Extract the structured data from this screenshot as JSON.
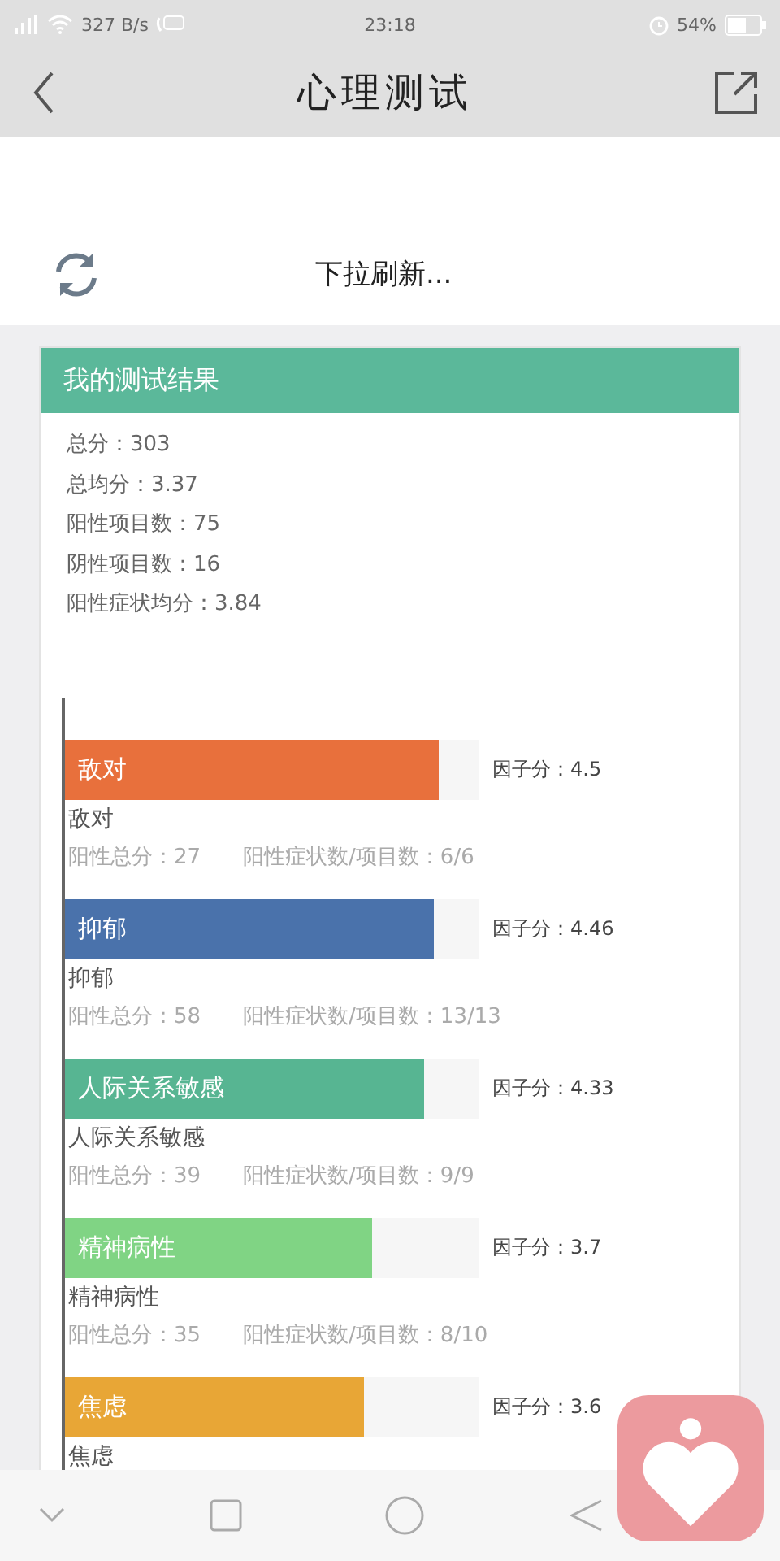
{
  "status_bar": {
    "speed": "327 B/s",
    "time": "23:18",
    "battery": "54%"
  },
  "header": {
    "title": "心理测试"
  },
  "refresh": {
    "label": "下拉刷新..."
  },
  "result_card": {
    "title": "我的测试结果",
    "summary": [
      "总分：303",
      "总均分：3.37",
      "阳性项目数：75",
      "阴性项目数：16",
      "阳性症状均分：3.84"
    ],
    "factors": [
      {
        "name": "敌对",
        "color": "#e8703c",
        "level": 0.9,
        "score": "因子分：4.5",
        "caption": "敌对",
        "positive_total": "阳性总分：27",
        "ratio": "阳性症状数/项目数：6/6"
      },
      {
        "name": "抑郁",
        "color": "#4a72ab",
        "level": 0.892,
        "score": "因子分：4.46",
        "caption": "抑郁",
        "positive_total": "阳性总分：58",
        "ratio": "阳性症状数/项目数：13/13"
      },
      {
        "name": "人际关系敏感",
        "color": "#57b592",
        "level": 0.866,
        "score": "因子分：4.33",
        "caption": "人际关系敏感",
        "positive_total": "阳性总分：39",
        "ratio": "阳性症状数/项目数：9/9"
      },
      {
        "name": "精神病性",
        "color": "#80d484",
        "level": 0.74,
        "score": "因子分：3.7",
        "caption": "精神病性",
        "positive_total": "阳性总分：35",
        "ratio": "阳性症状数/项目数：8/10"
      },
      {
        "name": "焦虑",
        "color": "#e8a636",
        "level": 0.72,
        "score": "因子分：3.6",
        "caption": "焦虑"
      }
    ]
  }
}
